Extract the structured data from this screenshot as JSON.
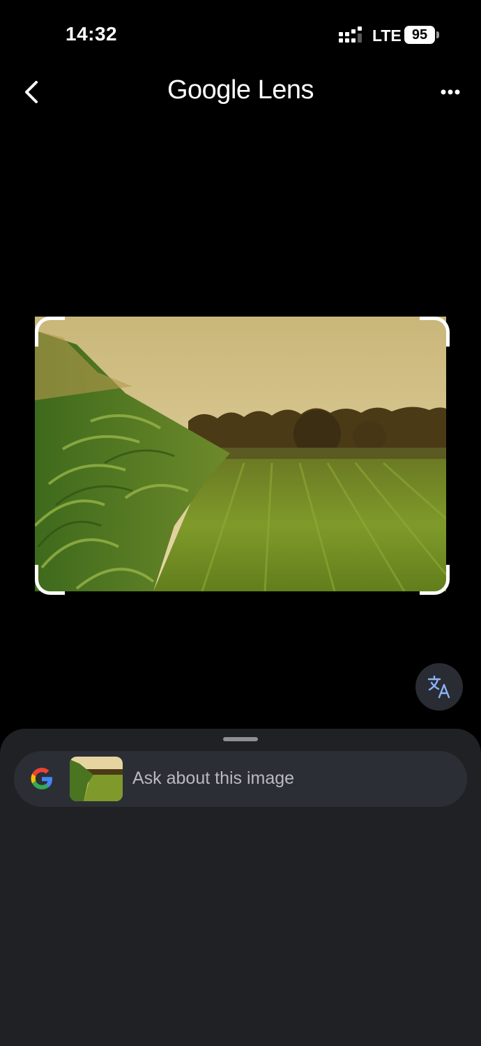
{
  "status_bar": {
    "time": "14:32",
    "network": "LTE",
    "battery": "95"
  },
  "header": {
    "title_brand": "Google",
    "title_product": "Lens"
  },
  "search": {
    "placeholder": "Ask about this image"
  },
  "icons": {
    "back": "chevron-left-icon",
    "more": "more-horizontal-icon",
    "translate": "translate-icon",
    "google": "google-g-icon"
  },
  "colors": {
    "background": "#000000",
    "sheet": "#202125",
    "search_bar": "#2c2e35",
    "translate_accent": "#8ab4f8"
  }
}
